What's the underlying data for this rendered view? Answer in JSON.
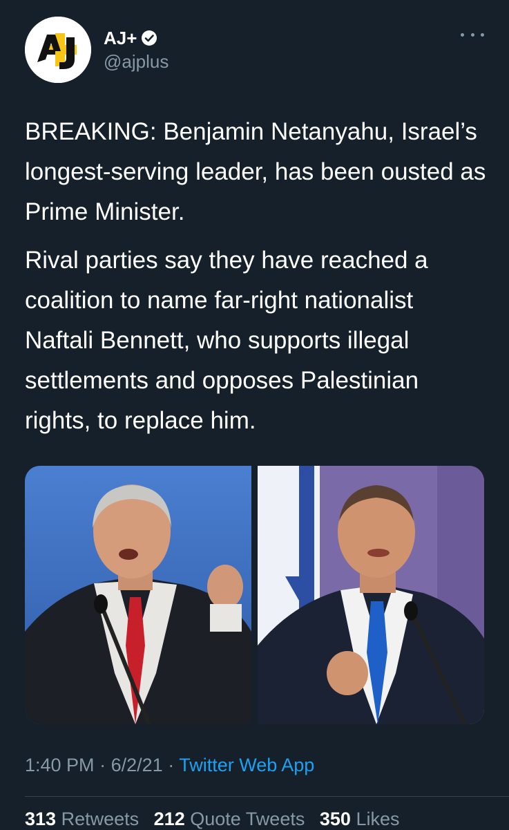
{
  "account": {
    "display_name": "AJ+",
    "handle": "@ajplus",
    "verified": true,
    "avatar_icon": "ajplus-logo-icon",
    "brand_color": "#f5c518"
  },
  "tweet": {
    "paragraphs": [
      "BREAKING: Benjamin Netanyahu, Israel’s longest-serving leader, has been ousted as Prime Minister.",
      "Rival parties say they have reached a coalition to name far-right nationalist Naftali Bennett, who supports illegal settlements and opposes Palestinian rights, to replace him."
    ],
    "media": [
      {
        "icon": "photo-netanyahu"
      },
      {
        "icon": "photo-bennett"
      }
    ],
    "time": "1:40 PM",
    "separator": "·",
    "date": "6/2/21",
    "source": "Twitter Web App",
    "accent_color": "#1da1f2"
  },
  "stats": {
    "retweets_count": "313",
    "retweets_label": "Retweets",
    "quote_count": "212",
    "quote_label": "Quote Tweets",
    "likes_count": "350",
    "likes_label": "Likes"
  }
}
